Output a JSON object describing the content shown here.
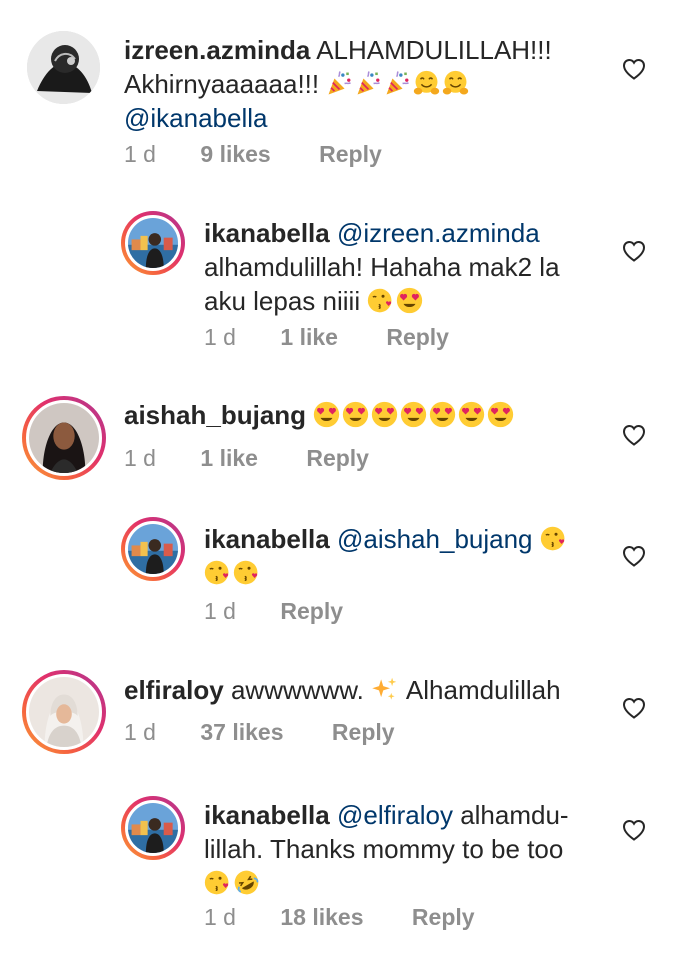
{
  "comments": [
    {
      "username": "izreen.azminda",
      "text_line1": "ALHAMDULILLAH!!!",
      "text_line2": "Akhirnyaaaaaa!!!",
      "mention": "@ikanabella",
      "emojis": [
        "party-popper",
        "party-popper",
        "party-popper",
        "hugging-face",
        "hugging-face"
      ],
      "time": "1 d",
      "likes": "9 likes",
      "reply": "Reply"
    },
    {
      "username": "ikanabella",
      "mention": "@izreen.azminda",
      "text_line1": "alhamdulillah! Hahaha mak2 la",
      "text_line2": "aku lepas niiii",
      "emojis": [
        "kissing-heart",
        "heart-eyes"
      ],
      "time": "1 d",
      "likes": "1 like",
      "reply": "Reply"
    },
    {
      "username": "aishah_bujang",
      "emojis": [
        "heart-eyes",
        "heart-eyes",
        "heart-eyes",
        "heart-eyes",
        "heart-eyes",
        "heart-eyes",
        "heart-eyes"
      ],
      "time": "1 d",
      "likes": "1 like",
      "reply": "Reply"
    },
    {
      "username": "ikanabella",
      "mention": "@aishah_bujang",
      "emojis": [
        "kissing-heart",
        "kissing-heart",
        "kissing-heart"
      ],
      "time": "1 d",
      "reply": "Reply"
    },
    {
      "username": "elfiraloy",
      "text_line1": "awwwwww.",
      "text_line1b": "Alhamdulillah",
      "emojis": [
        "sparkles"
      ],
      "time": "1 d",
      "likes": "37 likes",
      "reply": "Reply"
    },
    {
      "username": "ikanabella",
      "mention": "@elfiraloy",
      "text_line1": "alhamdu-",
      "text_line2": "lillah. Thanks mommy to be too",
      "emojis": [
        "kissing-heart",
        "rolling-laughing"
      ],
      "time": "1 d",
      "likes": "18 likes",
      "reply": "Reply"
    }
  ],
  "colors": {
    "text": "#262626",
    "mention": "#00376b",
    "meta": "#8e8e8e",
    "heart_outline": "#262626"
  }
}
